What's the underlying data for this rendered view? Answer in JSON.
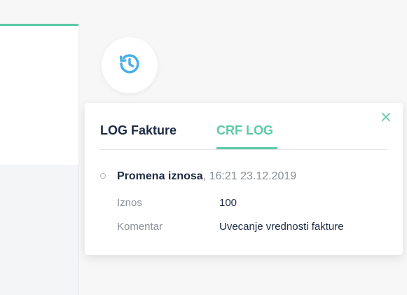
{
  "history_button": {
    "icon": "history-icon",
    "color": "#4aaee6"
  },
  "popover": {
    "close_icon": "close-icon",
    "tabs": [
      {
        "label": "LOG Fakture",
        "active": false
      },
      {
        "label": "CRF LOG",
        "active": true
      }
    ],
    "entry": {
      "title": "Promena iznosa",
      "separator": ",",
      "timestamp": "16:21 23.12.2019",
      "rows": [
        {
          "label": "Iznos",
          "value": "100"
        },
        {
          "label": "Komentar",
          "value": "Uvecanje vrednosti fakture"
        }
      ]
    }
  },
  "colors": {
    "accent": "#5cc9a7",
    "text_dark": "#1d2a44",
    "text_muted": "#8a8f99",
    "icon_blue": "#4aaee6"
  }
}
